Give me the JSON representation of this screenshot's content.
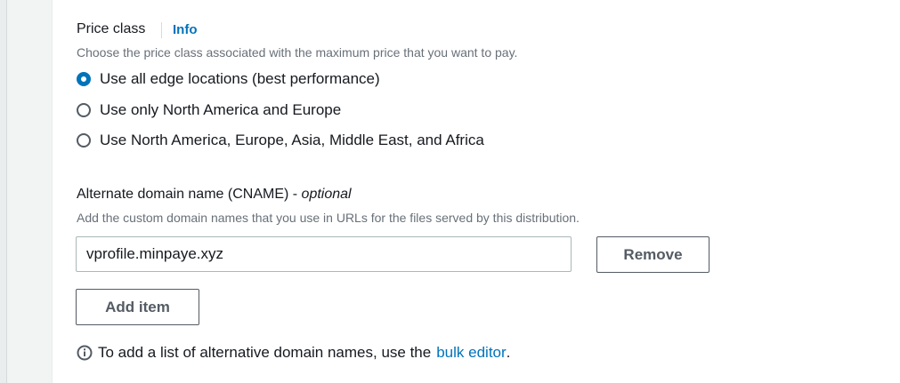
{
  "price_class": {
    "label": "Price class",
    "info_link": "Info",
    "description": "Choose the price class associated with the maximum price that you want to pay.",
    "options": [
      {
        "label": "Use all edge locations (best performance)",
        "selected": true
      },
      {
        "label": "Use only North America and Europe",
        "selected": false
      },
      {
        "label": "Use North America, Europe, Asia, Middle East, and Africa",
        "selected": false
      }
    ]
  },
  "cname": {
    "label": "Alternate domain name (CNAME)",
    "label_separator": "-",
    "label_optional": "optional",
    "description": "Add the custom domain names that you use in URLs for the files served by this distribution.",
    "items": [
      {
        "value": "vprofile.minpaye.xyz",
        "remove_label": "Remove"
      }
    ],
    "add_item_label": "Add item",
    "hint_prefix": "To add a list of alternative domain names, use the",
    "hint_link": "bulk editor",
    "hint_suffix": "."
  },
  "colors": {
    "accent": "#0073bb",
    "text": "#16191f",
    "muted": "#687078",
    "border": "#aab7b8"
  }
}
